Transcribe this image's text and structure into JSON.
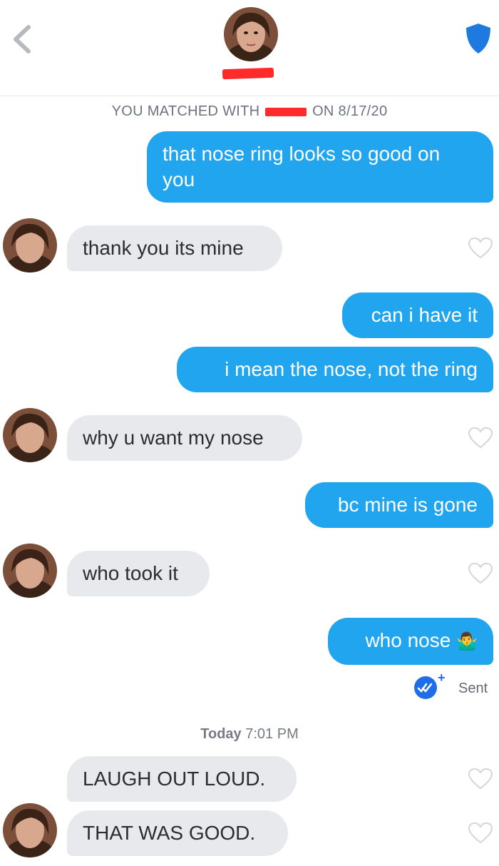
{
  "header": {
    "back_icon": "chevron-left-icon",
    "safety_icon": "shield-icon",
    "colors": {
      "accent": "#1f7ae0",
      "redaction": "#ff2b2b"
    }
  },
  "match_info": {
    "prefix": "YOU MATCHED WITH",
    "suffix": "ON 8/17/20"
  },
  "messages": [
    {
      "from": "me",
      "text": "that nose ring looks so good on you"
    },
    {
      "from": "them",
      "text": "thank you its mine"
    },
    {
      "from": "me",
      "text": "can i have it"
    },
    {
      "from": "me",
      "text": "i mean the nose, not the ring"
    },
    {
      "from": "them",
      "text": "why u want my nose"
    },
    {
      "from": "me",
      "text": "bc mine is gone"
    },
    {
      "from": "them",
      "text": "who took it"
    },
    {
      "from": "me",
      "text": "who nose",
      "emoji": "🤷‍♂️"
    },
    {
      "from": "them",
      "text": "LAUGH OUT LOUD."
    },
    {
      "from": "them",
      "text": "THAT WAS GOOD."
    }
  ],
  "status": {
    "plus": "+",
    "sent": "Sent",
    "icon": "double-check-icon"
  },
  "timestamp": {
    "day": "Today",
    "time": "7:01 PM"
  },
  "bubble_colors": {
    "outgoing": "#21a5ee",
    "incoming": "#e8e9ec"
  }
}
